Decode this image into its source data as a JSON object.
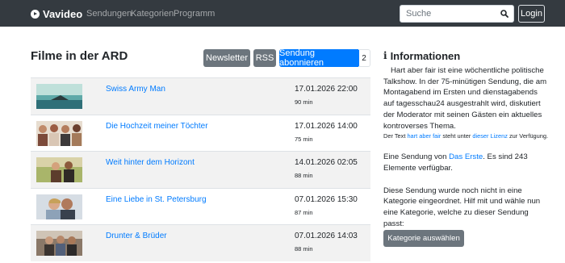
{
  "navbar": {
    "brand": "Vavideo",
    "links": [
      "Sendungen",
      "Kategorien",
      "Programm"
    ],
    "search_placeholder": "Suche",
    "login": "Login"
  },
  "main": {
    "title": "Filme in der ARD",
    "buttons": {
      "newsletter": "Newsletter",
      "rss": "RSS",
      "subscribe": "Sendung abonnieren",
      "subscriber_count": "2"
    },
    "items": [
      {
        "title": "Swiss Army Man",
        "date": "17.01.2026 22:00",
        "duration": "90 min"
      },
      {
        "title": "Die Hochzeit meiner Töchter",
        "date": "17.01.2026 14:00",
        "duration": "75 min"
      },
      {
        "title": "Weit hinter dem Horizont",
        "date": "14.01.2026 02:05",
        "duration": "88 min"
      },
      {
        "title": "Eine Liebe in St. Petersburg",
        "date": "07.01.2026 15:30",
        "duration": "87 min"
      },
      {
        "title": "Drunter & Brüder",
        "date": "07.01.2026 14:03",
        "duration": "88 min"
      }
    ]
  },
  "sidebar": {
    "heading": "Informationen",
    "description": "Hart aber fair ist eine wöchentliche politische Talkshow. In der 75-minütigen Sendung, die am Montagabend im Ersten und dienstagabends auf tagesschau24 ausgestrahlt wird, diskutiert der Moderator mit seinen Gästen ein aktuelles kontroverses Thema.",
    "license_prefix": "Der Text ",
    "license_link1": "hart aber fair",
    "license_mid": " steht unter ",
    "license_link2": "dieser Lizenz",
    "license_suffix": " zur Verfügung.",
    "sender_prefix": "Eine Sendung von ",
    "sender_link": "Das Erste",
    "sender_suffix": ". Es sind 243 Elemente verfügbar.",
    "category_text": "Diese Sendung wurde noch nicht in eine Kategorie eingeordnet. Hilf mit und wähle nun eine Kategorie, welche zu dieser Sendung passt:",
    "category_button": "Kategorie auswählen"
  }
}
